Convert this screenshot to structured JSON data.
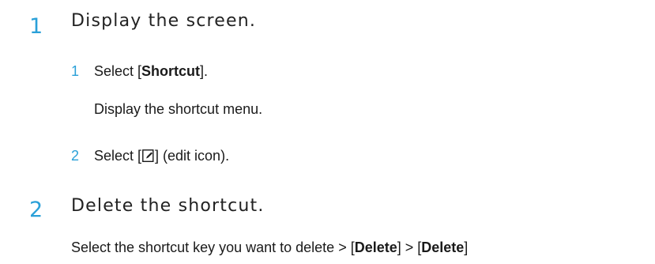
{
  "colors": {
    "accent": "#2aa0d8",
    "text": "#1a1a1a"
  },
  "steps": [
    {
      "number": "1",
      "title": "Display the screen.",
      "substeps": [
        {
          "number": "1",
          "text_prefix": "Select [",
          "text_bold": "Shortcut",
          "text_suffix": "].",
          "detail": "Display the shortcut menu."
        },
        {
          "number": "2",
          "text_prefix": "Select [",
          "icon": "edit-icon",
          "text_suffix": "] (edit icon)."
        }
      ]
    },
    {
      "number": "2",
      "title": "Delete the shortcut.",
      "body_prefix": "Select the shortcut key you want to delete > [",
      "body_bold_1": "Delete",
      "body_mid": "] > [",
      "body_bold_2": "Delete",
      "body_suffix": "]"
    }
  ]
}
